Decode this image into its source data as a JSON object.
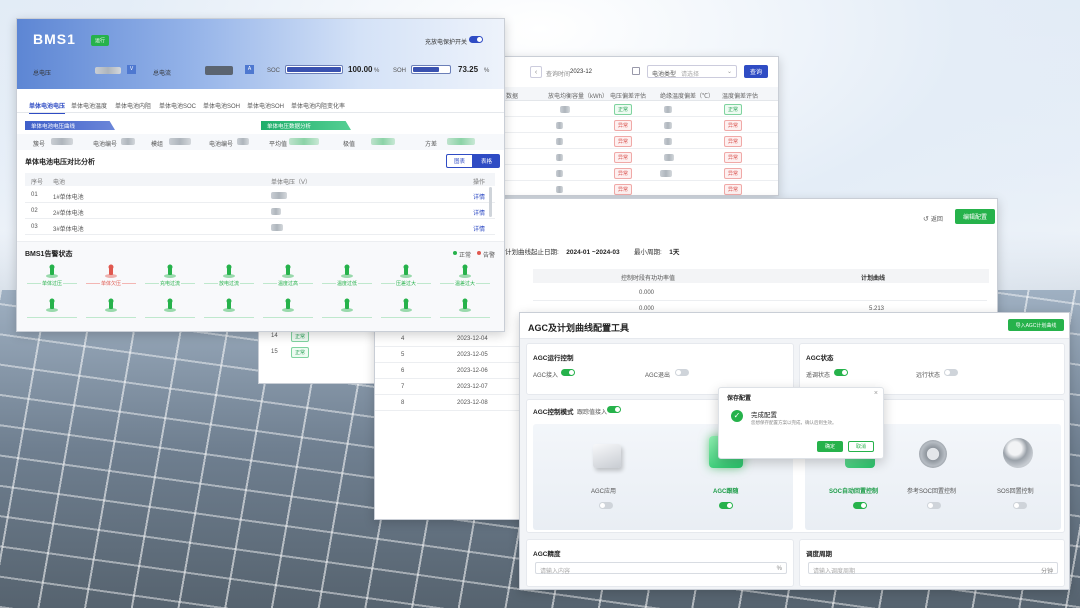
{
  "bms": {
    "brand": "BMS1",
    "status_tag": "运行",
    "toggle_label": "充放电保护开关",
    "battery_label": "总电压",
    "current_label": "总电流",
    "soc_label": "SOC",
    "soc_value": "100.00",
    "soc_unit": "%",
    "soh_label": "SOH",
    "soh_value": "73.25",
    "soh_unit": "%",
    "tabs": [
      "单体电池电压",
      "单体电池温度",
      "单体电池内阻",
      "单体电池SOC",
      "单体电池SOH",
      "单体电池SOH",
      "单体电池内阻变化率"
    ],
    "section_left": "单体电池电压曲线",
    "section_right": "单体电压数据分析",
    "filter_cluster": "簇号",
    "filter_cell_no": "电池编号",
    "filter_module": "模组",
    "filter_cell_no2": "电池编号",
    "filter_avg": "平均值",
    "filter_max": "极值",
    "filter_variance": "方差",
    "compare_title": "单体电池电压对比分析",
    "btn_chart": "图表",
    "btn_table": "表格",
    "table_headers": [
      "序号",
      "电池",
      "单体电压（V）",
      "操作"
    ],
    "table_rows": [
      {
        "no": "01",
        "name": "1#单体电池",
        "op": "详情"
      },
      {
        "no": "02",
        "name": "2#单体电池",
        "op": "详情"
      },
      {
        "no": "03",
        "name": "3#单体电池",
        "op": "详情"
      }
    ],
    "alarm_title": "BMS1告警状态",
    "legend_normal": "正常",
    "legend_alarm": "告警",
    "sensors_row1": [
      "单体过压",
      "单体欠压",
      "充电过流",
      "放电过流",
      "温度过高",
      "温度过低",
      "压差过大",
      "温差过大"
    ],
    "sensors_row2": [
      "",
      "",
      "",
      "",
      "",
      "",
      "",
      ""
    ]
  },
  "report": {
    "date_label": "查询时间",
    "date_value": "2023-12",
    "type_label": "电池类型",
    "type_placeholder": "请选择",
    "query_btn": "查询",
    "headers": [
      "数据",
      "放电均衡容量（kWh）",
      "电压偏差评估",
      "绝缘温度偏差（℃）",
      "温度偏差评估"
    ],
    "rows": [
      {
        "a": "正常",
        "b": "正常"
      },
      {
        "a": "异常",
        "b": "异常"
      },
      {
        "a": "异常",
        "b": "异常"
      },
      {
        "a": "异常",
        "b": "异常"
      },
      {
        "a": "异常",
        "b": "异常"
      },
      {
        "a": "异常",
        "b": "异常"
      }
    ],
    "sub_rows": [
      {
        "no": "14",
        "tag": "正常"
      },
      {
        "no": "15",
        "tag": "正常"
      }
    ]
  },
  "plan": {
    "back": "返回",
    "edit_btn": "编辑配置",
    "period_label": "计划曲线起止日期:",
    "period_value": "2024-01 ~2024-03",
    "min_period_label": "最小周期:",
    "min_period_value": "1天",
    "col_power": "控制时段有功功率值",
    "col_curve": "计划曲线",
    "rows": [
      {
        "power": "0.000",
        "curve": ""
      },
      {
        "power": "0.000",
        "curve": "5.213"
      }
    ],
    "list": [
      {
        "no": "4",
        "date": "2023-12-04"
      },
      {
        "no": "5",
        "date": "2023-12-05"
      },
      {
        "no": "6",
        "date": "2023-12-06"
      },
      {
        "no": "7",
        "date": "2023-12-07"
      },
      {
        "no": "8",
        "date": "2023-12-08"
      }
    ]
  },
  "agc": {
    "title": "AGC及计划曲线配置工具",
    "import_btn": "导入AGC计划曲线",
    "run_ctrl": "AGC运行控制",
    "agc_access": "AGC接入",
    "agc_exit": "AGC退出",
    "agc_status": "AGC状态",
    "remote_status": "遥调状态",
    "local_status": "远行状态",
    "ctrl_mode": "AGC控制模式",
    "ctrl_mode_sub": "跟踪值接入",
    "options": [
      "AGC应用",
      "AGC跟随",
      "SOC自动回置控制",
      "参考SOC回置控制",
      "SOS回置控制"
    ],
    "accuracy": "AGC精度",
    "accuracy_placeholder": "请输入内容",
    "accuracy_unit": "%",
    "dispatch_period": "调度周期",
    "dispatch_placeholder": "请输入调度周期",
    "dispatch_unit": "分钟",
    "dialog_title": "保存配置",
    "dialog_heading": "完成配置",
    "dialog_text": "您想保存配置方案以完成，确认后则生效。",
    "dialog_ok": "确定",
    "dialog_cancel": "取消"
  },
  "colors": {
    "accent_green": "#26b24b",
    "accent_blue": "#2f4cc4",
    "alarm_red": "#e0584f"
  }
}
